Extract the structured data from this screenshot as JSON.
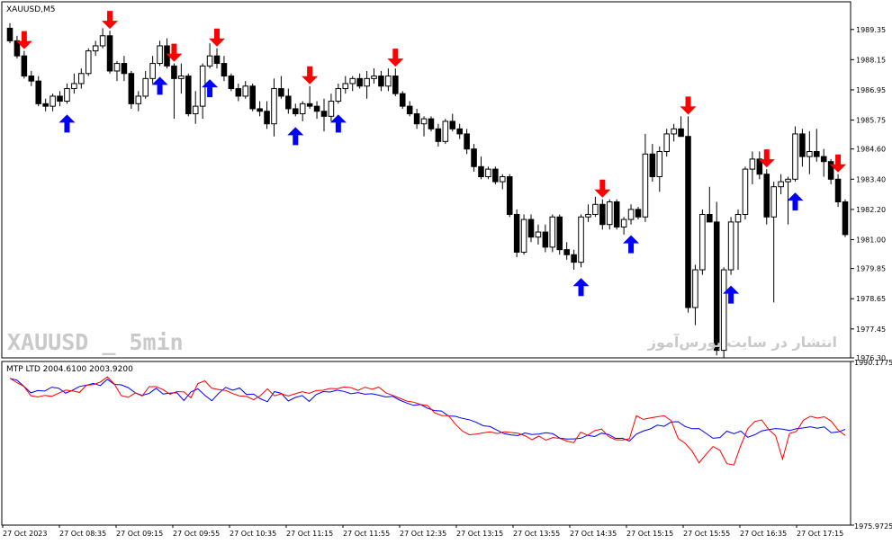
{
  "chart_data": [
    {
      "type": "candlestick",
      "symbol_label": "XAUUSD,M5",
      "ylim": [
        1976.3,
        1990.45
      ],
      "y_ticks": [
        "1989.35",
        "1988.15",
        "1986.95",
        "1985.75",
        "1984.60",
        "1983.40",
        "1982.20",
        "1981.00",
        "1979.85",
        "1978.65",
        "1977.45",
        "1976.30"
      ],
      "x_ticks": [
        "27 Oct 2023",
        "27 Oct 08:35",
        "27 Oct 09:15",
        "27 Oct 09:55",
        "27 Oct 10:35",
        "27 Oct 11:15",
        "27 Oct 11:55",
        "27 Oct 12:35",
        "27 Oct 13:15",
        "27 Oct 13:55",
        "27 Oct 14:35",
        "27 Oct 15:15",
        "27 Oct 15:55",
        "27 Oct 16:35",
        "27 Oct 17:15"
      ],
      "watermarks": [
        "XAUUSD _ 5min",
        "انتشار در سایت بورس‌آموز"
      ],
      "ohlc": [
        [
          1989.4,
          1989.6,
          1988.8,
          1988.9
        ],
        [
          1988.9,
          1989.1,
          1988.2,
          1988.3
        ],
        [
          1988.3,
          1988.5,
          1987.4,
          1987.5
        ],
        [
          1987.5,
          1987.7,
          1987.1,
          1987.3
        ],
        [
          1987.3,
          1987.5,
          1986.3,
          1986.4
        ],
        [
          1986.4,
          1986.6,
          1986.1,
          1986.3
        ],
        [
          1986.3,
          1986.8,
          1986.1,
          1986.7
        ],
        [
          1986.7,
          1986.9,
          1986.3,
          1986.5
        ],
        [
          1986.5,
          1987.2,
          1986.4,
          1987.0
        ],
        [
          1987.0,
          1987.6,
          1986.8,
          1987.2
        ],
        [
          1987.2,
          1987.8,
          1987.0,
          1987.6
        ],
        [
          1987.6,
          1988.6,
          1987.5,
          1988.5
        ],
        [
          1988.5,
          1988.9,
          1988.3,
          1988.7
        ],
        [
          1988.7,
          1989.4,
          1988.6,
          1989.1
        ],
        [
          1989.1,
          1989.3,
          1987.6,
          1987.7
        ],
        [
          1987.7,
          1988.1,
          1987.3,
          1988.0
        ],
        [
          1988.0,
          1988.3,
          1987.3,
          1987.6
        ],
        [
          1987.6,
          1987.7,
          1986.2,
          1986.4
        ],
        [
          1986.4,
          1986.9,
          1986.1,
          1986.7
        ],
        [
          1986.7,
          1987.7,
          1986.6,
          1987.4
        ],
        [
          1987.4,
          1988.3,
          1987.2,
          1988.0
        ],
        [
          1988.0,
          1988.9,
          1987.9,
          1988.7
        ],
        [
          1988.7,
          1989.0,
          1987.8,
          1987.9
        ],
        [
          1987.9,
          1988.0,
          1985.8,
          1987.4
        ],
        [
          1987.4,
          1988.0,
          1986.8,
          1987.5
        ],
        [
          1987.5,
          1987.6,
          1985.9,
          1986.0
        ],
        [
          1986.0,
          1986.9,
          1985.6,
          1986.3
        ],
        [
          1986.3,
          1988.0,
          1985.8,
          1987.9
        ],
        [
          1987.9,
          1988.8,
          1987.8,
          1988.3
        ],
        [
          1988.3,
          1988.6,
          1987.8,
          1988.0
        ],
        [
          1988.0,
          1988.3,
          1987.3,
          1987.5
        ],
        [
          1987.5,
          1987.6,
          1986.9,
          1987.0
        ],
        [
          1987.0,
          1987.2,
          1986.5,
          1986.7
        ],
        [
          1986.7,
          1987.3,
          1986.6,
          1987.1
        ],
        [
          1987.1,
          1987.2,
          1986.1,
          1986.2
        ],
        [
          1986.2,
          1986.5,
          1985.9,
          1986.1
        ],
        [
          1986.1,
          1986.5,
          1985.4,
          1985.6
        ],
        [
          1985.6,
          1987.4,
          1985.1,
          1987.0
        ],
        [
          1987.0,
          1987.5,
          1986.6,
          1986.7
        ],
        [
          1986.7,
          1987.0,
          1986.0,
          1986.2
        ],
        [
          1986.2,
          1986.4,
          1985.9,
          1986.0
        ],
        [
          1986.0,
          1986.5,
          1985.7,
          1986.4
        ],
        [
          1986.4,
          1987.1,
          1986.2,
          1986.3
        ],
        [
          1986.3,
          1986.5,
          1985.8,
          1986.1
        ],
        [
          1986.1,
          1986.6,
          1985.3,
          1985.9
        ],
        [
          1985.9,
          1986.8,
          1985.7,
          1986.5
        ],
        [
          1986.5,
          1987.2,
          1986.4,
          1987.0
        ],
        [
          1987.0,
          1987.5,
          1986.8,
          1987.2
        ],
        [
          1987.2,
          1987.5,
          1986.9,
          1987.4
        ],
        [
          1987.4,
          1987.6,
          1987.0,
          1987.1
        ],
        [
          1987.1,
          1987.7,
          1986.6,
          1987.4
        ],
        [
          1987.4,
          1987.8,
          1987.2,
          1987.5
        ],
        [
          1987.5,
          1987.7,
          1986.9,
          1987.1
        ],
        [
          1987.1,
          1987.8,
          1986.9,
          1987.5
        ],
        [
          1987.5,
          1987.8,
          1986.7,
          1986.8
        ],
        [
          1986.8,
          1986.9,
          1986.2,
          1986.3
        ],
        [
          1986.3,
          1986.5,
          1985.9,
          1986.0
        ],
        [
          1986.0,
          1986.2,
          1985.4,
          1985.6
        ],
        [
          1985.6,
          1985.9,
          1985.1,
          1985.8
        ],
        [
          1985.8,
          1985.9,
          1985.3,
          1985.4
        ],
        [
          1985.4,
          1985.6,
          1984.7,
          1984.9
        ],
        [
          1984.9,
          1985.8,
          1984.8,
          1985.7
        ],
        [
          1985.7,
          1986.0,
          1985.3,
          1985.4
        ],
        [
          1985.4,
          1985.6,
          1985.0,
          1985.2
        ],
        [
          1985.2,
          1985.4,
          1984.4,
          1984.6
        ],
        [
          1984.6,
          1984.8,
          1983.7,
          1983.9
        ],
        [
          1983.9,
          1984.3,
          1983.4,
          1983.5
        ],
        [
          1983.5,
          1983.9,
          1983.4,
          1983.8
        ],
        [
          1983.8,
          1983.9,
          1983.2,
          1983.3
        ],
        [
          1983.3,
          1983.6,
          1983.0,
          1983.5
        ],
        [
          1983.5,
          1983.6,
          1981.9,
          1982.0
        ],
        [
          1982.0,
          1982.2,
          1980.3,
          1980.5
        ],
        [
          1980.5,
          1982.0,
          1980.4,
          1981.8
        ],
        [
          1981.8,
          1982.0,
          1980.9,
          1981.1
        ],
        [
          1981.1,
          1981.6,
          1980.8,
          1981.3
        ],
        [
          1981.3,
          1981.6,
          1980.5,
          1980.7
        ],
        [
          1980.7,
          1982.0,
          1980.5,
          1981.9
        ],
        [
          1981.9,
          1982.0,
          1980.4,
          1980.6
        ],
        [
          1980.6,
          1980.9,
          1980.2,
          1980.4
        ],
        [
          1980.4,
          1980.6,
          1979.8,
          1980.1
        ],
        [
          1980.1,
          1982.0,
          1979.9,
          1981.9
        ],
        [
          1981.9,
          1982.4,
          1981.7,
          1982.0
        ],
        [
          1982.0,
          1982.7,
          1981.9,
          1982.4
        ],
        [
          1982.4,
          1982.6,
          1981.4,
          1981.6
        ],
        [
          1981.6,
          1982.6,
          1981.4,
          1982.5
        ],
        [
          1982.5,
          1982.6,
          1981.4,
          1981.5
        ],
        [
          1981.5,
          1981.9,
          1981.2,
          1981.8
        ],
        [
          1981.8,
          1982.4,
          1981.6,
          1982.2
        ],
        [
          1982.2,
          1982.3,
          1981.8,
          1981.9
        ],
        [
          1981.9,
          1985.2,
          1981.7,
          1984.4
        ],
        [
          1984.4,
          1984.8,
          1983.3,
          1983.5
        ],
        [
          1983.5,
          1984.7,
          1982.9,
          1984.5
        ],
        [
          1984.5,
          1985.4,
          1984.3,
          1985.2
        ],
        [
          1985.2,
          1985.6,
          1984.9,
          1985.4
        ],
        [
          1985.4,
          1985.9,
          1985.3,
          1985.1
        ],
        [
          1985.1,
          1985.9,
          1978.1,
          1978.3
        ],
        [
          1978.3,
          1980.0,
          1977.6,
          1979.8
        ],
        [
          1979.8,
          1982.2,
          1979.6,
          1982.0
        ],
        [
          1982.0,
          1983.1,
          1981.8,
          1981.7
        ],
        [
          1981.7,
          1982.5,
          1976.4,
          1976.6
        ],
        [
          1976.6,
          1979.9,
          1976.3,
          1979.8
        ],
        [
          1979.8,
          1981.9,
          1979.6,
          1981.7
        ],
        [
          1981.7,
          1982.2,
          1979.8,
          1982.0
        ],
        [
          1982.0,
          1983.9,
          1981.8,
          1983.8
        ],
        [
          1983.8,
          1984.5,
          1983.2,
          1984.2
        ],
        [
          1984.2,
          1984.5,
          1983.4,
          1983.6
        ],
        [
          1983.6,
          1983.8,
          1981.6,
          1981.9
        ],
        [
          1981.9,
          1983.3,
          1978.5,
          1983.1
        ],
        [
          1983.1,
          1983.6,
          1982.8,
          1983.3
        ],
        [
          1983.3,
          1983.5,
          1981.6,
          1983.4
        ],
        [
          1983.4,
          1985.5,
          1983.3,
          1985.2
        ],
        [
          1985.2,
          1985.4,
          1983.9,
          1984.3
        ],
        [
          1984.3,
          1985.3,
          1983.6,
          1984.5
        ],
        [
          1984.5,
          1985.4,
          1984.1,
          1984.3
        ],
        [
          1984.3,
          1984.6,
          1983.5,
          1984.1
        ],
        [
          1984.1,
          1984.2,
          1983.2,
          1983.4
        ],
        [
          1983.4,
          1983.6,
          1982.3,
          1982.5
        ],
        [
          1982.5,
          1982.6,
          1981.1,
          1981.2
        ]
      ],
      "signals": [
        {
          "type": "sell",
          "bar": 2
        },
        {
          "type": "sell",
          "bar": 14
        },
        {
          "type": "sell",
          "bar": 23
        },
        {
          "type": "sell",
          "bar": 29
        },
        {
          "type": "sell",
          "bar": 42
        },
        {
          "type": "sell",
          "bar": 54
        },
        {
          "type": "sell",
          "bar": 83
        },
        {
          "type": "sell",
          "bar": 95
        },
        {
          "type": "sell",
          "bar": 106
        },
        {
          "type": "sell",
          "bar": 116
        },
        {
          "type": "buy",
          "bar": 8
        },
        {
          "type": "buy",
          "bar": 21
        },
        {
          "type": "buy",
          "bar": 28
        },
        {
          "type": "buy",
          "bar": 40
        },
        {
          "type": "buy",
          "bar": 46
        },
        {
          "type": "buy",
          "bar": 80
        },
        {
          "type": "buy",
          "bar": 87
        },
        {
          "type": "buy",
          "bar": 101
        },
        {
          "type": "buy",
          "bar": 110
        }
      ],
      "colors": {
        "bull_body": "#ffffff",
        "bear_body": "#000000",
        "wick": "#000000",
        "sell_arrow": "#ff0000",
        "buy_arrow": "#0000ff"
      }
    },
    {
      "type": "line",
      "indicator_label": "MTP LTD 2004.6100 2003.9200",
      "ylim": [
        1975.9725,
        1990.1775
      ],
      "y_ticks": [
        "1990.1775",
        "1975.9725"
      ],
      "series": [
        {
          "color": "#0000ff",
          "values": [
            89.6,
            88.6,
            84.9,
            80.8,
            82.2,
            81.9,
            84.3,
            83.7,
            80.6,
            82.4,
            84.7,
            85.5,
            86.6,
            85.3,
            89.1,
            86.0,
            85.7,
            84.0,
            80.9,
            79.3,
            80.5,
            83.6,
            80.1,
            80.7,
            80.9,
            76.1,
            81.4,
            83.3,
            79.4,
            76.0,
            80.6,
            84.2,
            82.4,
            83.8,
            79.8,
            80.1,
            77.2,
            75.4,
            81.6,
            80.5,
            75.8,
            78.0,
            79.2,
            75.6,
            79.8,
            81.6,
            81.3,
            82.5,
            81.7,
            80.3,
            81.0,
            80.0,
            80.3,
            79.4,
            78.3,
            78.7,
            76.4,
            74.6,
            73.2,
            73.7,
            71.4,
            70.0,
            69.7,
            66.7,
            66.5,
            65.2,
            64.4,
            62.8,
            60.7,
            60.2,
            58.0,
            55.9,
            55.1,
            54.7,
            56.3,
            55.4,
            55.6,
            56.5,
            55.8,
            53.2,
            52.6,
            52.7,
            53.1,
            54.9,
            54.1,
            56.2,
            55.4,
            53.0,
            53.1,
            51.4,
            55.6,
            57.5,
            58.8,
            61.1,
            60.4,
            63.1,
            63.2,
            60.3,
            58.9,
            59.0,
            56.1,
            53.1,
            53.5,
            57.4,
            55.9,
            57.5,
            53.7,
            55.2,
            57.6,
            58.4,
            59.0,
            58.7,
            57.8,
            58.9,
            59.4,
            60.1,
            59.2,
            60.0,
            56.5,
            57.0,
            58.5
          ]
        },
        {
          "color": "#ff0000",
          "values": [
            89.8,
            87.1,
            84.8,
            79.1,
            78.3,
            79.3,
            78.7,
            80.6,
            82.5,
            82.0,
            81.1,
            85.5,
            85.9,
            87.4,
            90.6,
            86.2,
            79.1,
            78.1,
            80.8,
            78.9,
            84.6,
            84.6,
            82.8,
            80.0,
            81.6,
            81.4,
            77.8,
            86.5,
            88.2,
            83.6,
            82.8,
            82.3,
            80.4,
            78.9,
            78.6,
            76.6,
            79.2,
            83.3,
            79.0,
            80.2,
            78.9,
            80.3,
            81.5,
            80.5,
            82.2,
            82.4,
            83.5,
            83.3,
            84.4,
            84.0,
            82.3,
            84.3,
            83.1,
            84.3,
            80.9,
            79.3,
            77.5,
            75.8,
            75.1,
            73.7,
            73.1,
            68.7,
            67.0,
            66.9,
            61.7,
            57.5,
            55.2,
            55.6,
            56.4,
            57.0,
            56.0,
            57.0,
            56.6,
            56.1,
            54.6,
            52.2,
            54.4,
            51.9,
            53.5,
            53.0,
            51.4,
            50.4,
            56.8,
            54.9,
            57.7,
            58.7,
            54.1,
            52.2,
            52.0,
            52.8,
            66.8,
            64.6,
            65.5,
            66.2,
            66.8,
            63.8,
            53.0,
            50.0,
            45.2,
            38.1,
            43.2,
            48.0,
            45.7,
            37.6,
            36.7,
            48.7,
            58.9,
            63.3,
            64.3,
            58.5,
            54.6,
            40.3,
            56.0,
            57.3,
            64.1,
            66.5,
            65.4,
            66.2,
            63.5,
            58.0,
            54.8
          ]
        }
      ]
    }
  ]
}
